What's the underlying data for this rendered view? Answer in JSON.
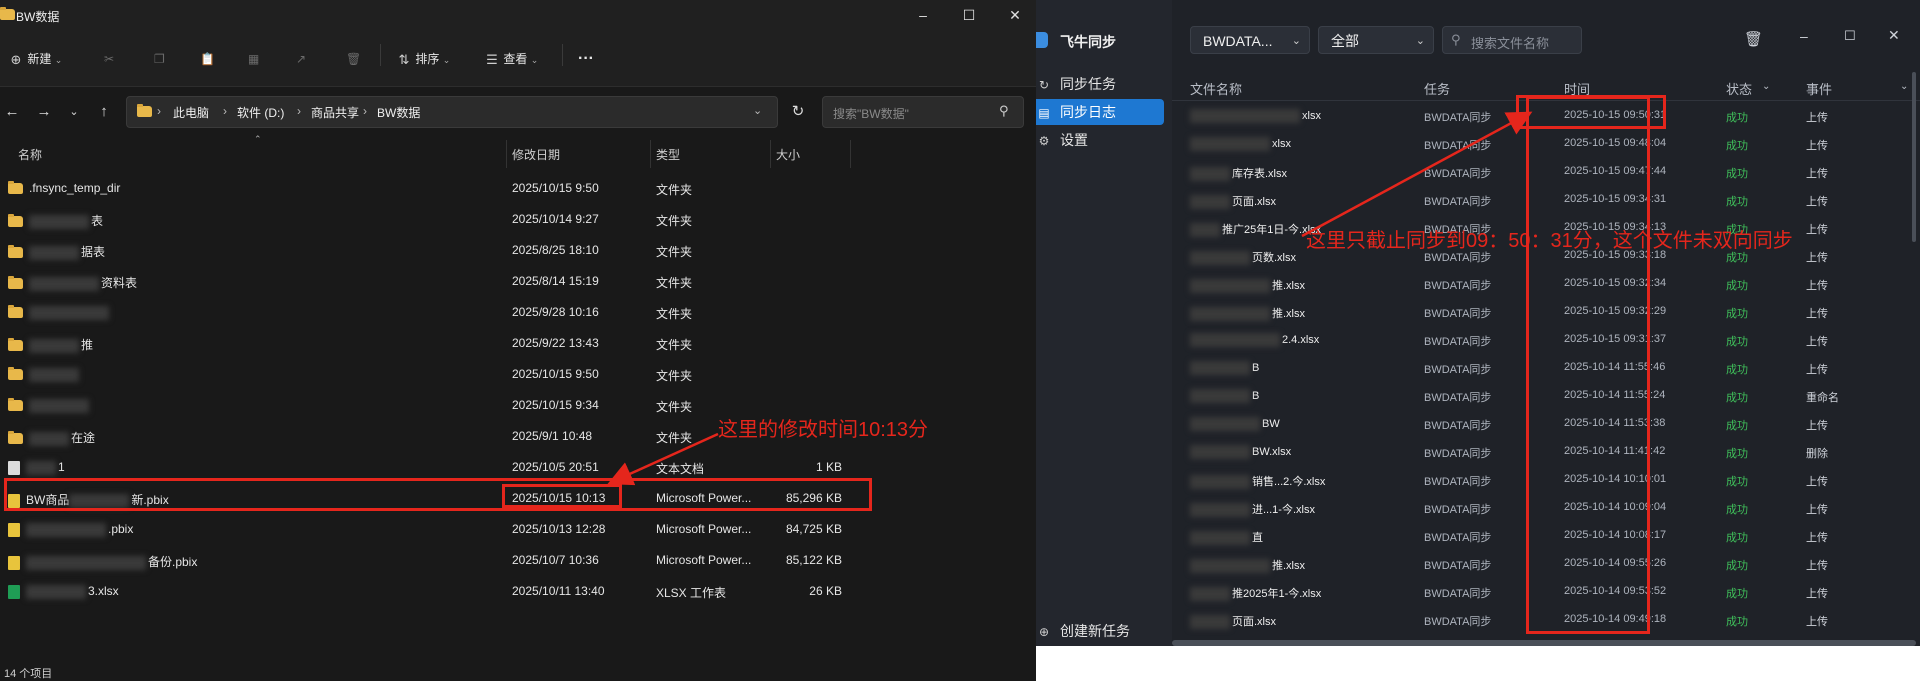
{
  "explorer": {
    "title": "BW数据",
    "toolbar": {
      "new": "新建",
      "sort": "排序",
      "view": "查看",
      "more": "···"
    },
    "breadcrumb": [
      "此电脑",
      "软件 (D:)",
      "商品共享",
      "BW数据"
    ],
    "search_placeholder": "搜索\"BW数据\"",
    "columns": {
      "name": "名称",
      "modified": "修改日期",
      "type": "类型",
      "size": "大小"
    },
    "rows": [
      {
        "name": ".fnsync_temp_dir",
        "date": "2025/10/15 9:50",
        "type": "文件夹",
        "size": ""
      },
      {
        "name": "表",
        "date": "2025/10/14 9:27",
        "type": "文件夹",
        "size": ""
      },
      {
        "name": "据表",
        "date": "2025/8/25 18:10",
        "type": "文件夹",
        "size": ""
      },
      {
        "name": "资料表",
        "date": "2025/8/14 15:19",
        "type": "文件夹",
        "size": ""
      },
      {
        "name": "",
        "date": "2025/9/28 10:16",
        "type": "文件夹",
        "size": ""
      },
      {
        "name": "推",
        "date": "2025/9/22 13:43",
        "type": "文件夹",
        "size": ""
      },
      {
        "name": "",
        "date": "2025/10/15 9:50",
        "type": "文件夹",
        "size": ""
      },
      {
        "name": "",
        "date": "2025/10/15 9:34",
        "type": "文件夹",
        "size": ""
      },
      {
        "name": "在途",
        "date": "2025/9/1 10:48",
        "type": "文件夹",
        "size": ""
      },
      {
        "name": "1",
        "date": "2025/10/5 20:51",
        "type": "文本文档",
        "size": "1 KB"
      },
      {
        "name": "BW商品",
        "name2": "新.pbix",
        "date": "2025/10/15 10:13",
        "type": "Microsoft Power...",
        "size": "85,296 KB"
      },
      {
        "name": ".pbix",
        "date": "2025/10/13 12:28",
        "type": "Microsoft Power...",
        "size": "84,725 KB"
      },
      {
        "name": "备份.pbix",
        "date": "2025/10/7 10:36",
        "type": "Microsoft Power...",
        "size": "85,122 KB"
      },
      {
        "name": "3.xlsx",
        "date": "2025/10/11 13:40",
        "type": "XLSX 工作表",
        "size": "26 KB"
      }
    ],
    "status": "14 个项目"
  },
  "sync": {
    "app_name": "飞牛同步",
    "nav": [
      "同步任务",
      "同步日志",
      "设置"
    ],
    "create_task": "创建新任务",
    "task_select": "BWDATA...",
    "filter_select": "全部",
    "search_placeholder": "搜索文件名称",
    "columns": {
      "name": "文件名称",
      "task": "任务",
      "time": "时间",
      "status": "状态",
      "event": "事件"
    },
    "rows": [
      {
        "name": "xlsx",
        "task": "BWDATA同步",
        "time": "2025-10-15 09:50:31",
        "status": "成功",
        "event": "上传"
      },
      {
        "name": "xlsx",
        "task": "BWDATA同步",
        "time": "2025-10-15 09:48:04",
        "status": "成功",
        "event": "上传"
      },
      {
        "name": "库存表.xlsx",
        "task": "BWDATA同步",
        "time": "2025-10-15 09:47:44",
        "status": "成功",
        "event": "上传"
      },
      {
        "name": "页面.xlsx",
        "task": "BWDATA同步",
        "time": "2025-10-15 09:34:31",
        "status": "成功",
        "event": "上传"
      },
      {
        "name": "推广25年1日-今.xlsx",
        "task": "BWDATA同步",
        "time": "2025-10-15 09:34:13",
        "status": "成功",
        "event": "上传"
      },
      {
        "name": "页数.xlsx",
        "task": "BWDATA同步",
        "time": "2025-10-15 09:33:18",
        "status": "成功",
        "event": "上传"
      },
      {
        "name": "推.xlsx",
        "task": "BWDATA同步",
        "time": "2025-10-15 09:32:34",
        "status": "成功",
        "event": "上传"
      },
      {
        "name": "推.xlsx",
        "task": "BWDATA同步",
        "time": "2025-10-15 09:32:29",
        "status": "成功",
        "event": "上传"
      },
      {
        "name": "2.4.xlsx",
        "task": "BWDATA同步",
        "time": "2025-10-15 09:31:37",
        "status": "成功",
        "event": "上传"
      },
      {
        "name": "B",
        "task": "BWDATA同步",
        "time": "2025-10-14 11:55:46",
        "status": "成功",
        "event": "上传"
      },
      {
        "name": "B",
        "task": "BWDATA同步",
        "time": "2025-10-14 11:55:24",
        "status": "成功",
        "event": "重命名"
      },
      {
        "name": "BW",
        "task": "BWDATA同步",
        "time": "2025-10-14 11:53:38",
        "status": "成功",
        "event": "上传"
      },
      {
        "name": "BW.xlsx",
        "task": "BWDATA同步",
        "time": "2025-10-14 11:41:42",
        "status": "成功",
        "event": "删除"
      },
      {
        "name": "销售...2.今.xlsx",
        "task": "BWDATA同步",
        "time": "2025-10-14 10:10:01",
        "status": "成功",
        "event": "上传"
      },
      {
        "name": "进...1-今.xlsx",
        "task": "BWDATA同步",
        "time": "2025-10-14 10:09:04",
        "status": "成功",
        "event": "上传"
      },
      {
        "name": "直",
        "task": "BWDATA同步",
        "time": "2025-10-14 10:08:17",
        "status": "成功",
        "event": "上传"
      },
      {
        "name": "推.xlsx",
        "task": "BWDATA同步",
        "time": "2025-10-14 09:55:26",
        "status": "成功",
        "event": "上传"
      },
      {
        "name": "推2025年1-今.xlsx",
        "task": "BWDATA同步",
        "time": "2025-10-14 09:53:52",
        "status": "成功",
        "event": "上传"
      },
      {
        "name": "页面.xlsx",
        "task": "BWDATA同步",
        "time": "2025-10-14 09:49:18",
        "status": "成功",
        "event": "上传"
      }
    ]
  },
  "annotations": {
    "left_note": "这里的修改时间10:13分",
    "right_note": "这里只截止同步到09：50：31分，这个文件未双向同步"
  }
}
